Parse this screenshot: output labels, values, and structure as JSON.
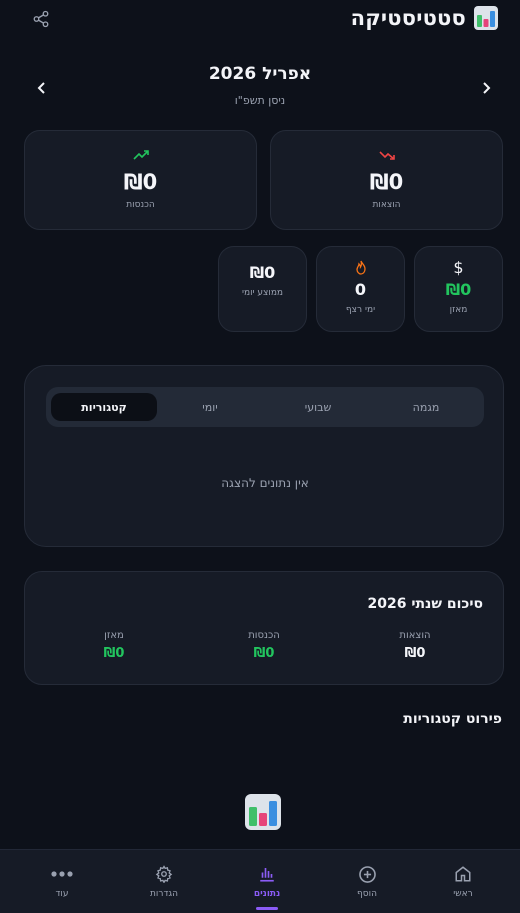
{
  "header": {
    "title": "סטטיסטיקה",
    "month": "אפריל 2026",
    "hebrew_date": "ניסן תשפ\"ו"
  },
  "summary": {
    "expenses": {
      "amount": "₪0",
      "label": "הוצאות"
    },
    "income": {
      "amount": "₪0",
      "label": "הכנסות"
    }
  },
  "stats": {
    "balance": {
      "icon": "$",
      "amount": "₪0",
      "label": "מאזן"
    },
    "streak": {
      "amount": "0",
      "label": "ימי רצף"
    },
    "daily_avg": {
      "amount": "₪0",
      "label": "ממוצע יומי"
    }
  },
  "chart": {
    "tabs": [
      "מגמה",
      "שבועי",
      "יומי",
      "קטגוריות"
    ],
    "active_tab": "קטגוריות",
    "empty_message": "אין נתונים להצגה"
  },
  "yearly": {
    "title": "סיכום שנתי 2026",
    "expenses_label": "הוצאות",
    "expenses_value": "₪0",
    "income_label": "הכנסות",
    "income_value": "₪0",
    "balance_label": "מאזן",
    "balance_value": "₪0"
  },
  "breakdown": {
    "title": "פירוט קטגוריות"
  },
  "bottom_nav": {
    "items": [
      {
        "label": "ראשי",
        "icon": "home-icon"
      },
      {
        "label": "הוסף",
        "icon": "plus-circle-icon"
      },
      {
        "label": "נתונים",
        "icon": "bar-chart-icon"
      },
      {
        "label": "הגדרות",
        "icon": "gear-icon"
      },
      {
        "label": "עוד",
        "icon": "more-dots-icon"
      }
    ],
    "active": "נתונים"
  },
  "colors": {
    "background": "#0d111a",
    "card": "#161b26",
    "accent": "#8b5cf6",
    "positive": "#22c55e",
    "negative": "#ef4444",
    "streak": "#f97316"
  }
}
